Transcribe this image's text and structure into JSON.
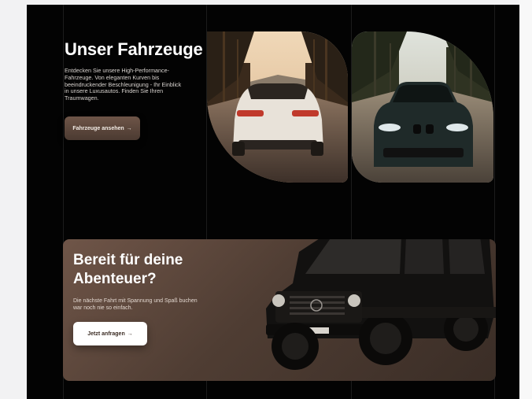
{
  "hero": {
    "title": "Unser Fahrzeuge",
    "description": "Entdecken Sie unsere High-Performance-Fahrzeuge. Von eleganten Kurven bis beeindruckender Beschleunigung - Ihr Einblick in unsere Luxusautos. Finden Sie Ihren Traumwagen.",
    "button_label": "Fahrzeuge ansehen",
    "button_icon": "arrow-right-icon"
  },
  "cta": {
    "title": "Bereit für deine Abenteuer?",
    "description": "Die nächste Fahrt mit Spannung und Spaß buchen war noch nie so einfach.",
    "button_label": "Jetzt anfragen",
    "button_icon": "arrow-right-icon"
  },
  "colors": {
    "background": "#030303",
    "accent_brown": "#5e473b",
    "text_light": "#ffffff"
  },
  "arrow_glyph": "→"
}
